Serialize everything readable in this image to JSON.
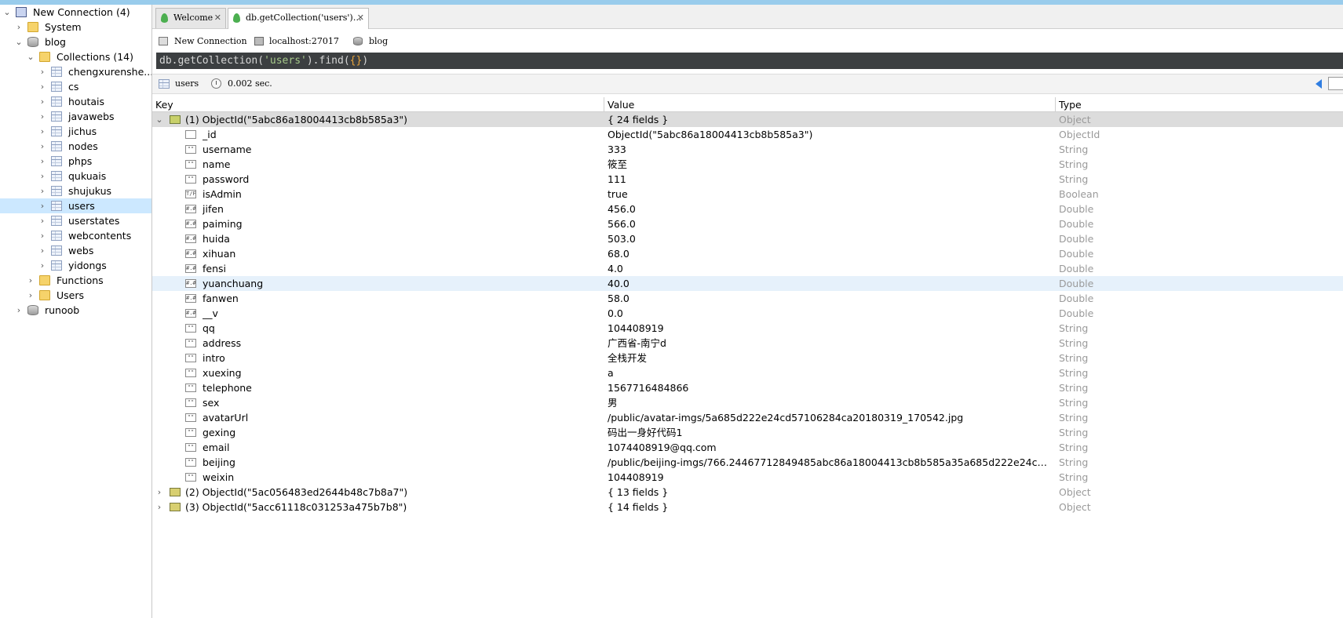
{
  "sidebar": {
    "items": [
      {
        "label": "New Connection (4)",
        "icon": "connection-icon",
        "depth": 0,
        "expand": "expanded"
      },
      {
        "label": "System",
        "icon": "folder-icon",
        "depth": 1,
        "expand": "collapsed"
      },
      {
        "label": "blog",
        "icon": "database-icon",
        "depth": 1,
        "expand": "expanded"
      },
      {
        "label": "Collections (14)",
        "icon": "folder-icon",
        "depth": 2,
        "expand": "expanded"
      },
      {
        "label": "chengxurenshe...",
        "icon": "collection-icon",
        "depth": 3,
        "expand": "collapsed"
      },
      {
        "label": "cs",
        "icon": "collection-icon",
        "depth": 3,
        "expand": "collapsed"
      },
      {
        "label": "houtais",
        "icon": "collection-icon",
        "depth": 3,
        "expand": "collapsed"
      },
      {
        "label": "javawebs",
        "icon": "collection-icon",
        "depth": 3,
        "expand": "collapsed"
      },
      {
        "label": "jichus",
        "icon": "collection-icon",
        "depth": 3,
        "expand": "collapsed"
      },
      {
        "label": "nodes",
        "icon": "collection-icon",
        "depth": 3,
        "expand": "collapsed"
      },
      {
        "label": "phps",
        "icon": "collection-icon",
        "depth": 3,
        "expand": "collapsed"
      },
      {
        "label": "qukuais",
        "icon": "collection-icon",
        "depth": 3,
        "expand": "collapsed"
      },
      {
        "label": "shujukus",
        "icon": "collection-icon",
        "depth": 3,
        "expand": "collapsed"
      },
      {
        "label": "users",
        "icon": "collection-icon",
        "depth": 3,
        "expand": "collapsed",
        "selected": true
      },
      {
        "label": "userstates",
        "icon": "collection-icon",
        "depth": 3,
        "expand": "collapsed"
      },
      {
        "label": "webcontents",
        "icon": "collection-icon",
        "depth": 3,
        "expand": "collapsed"
      },
      {
        "label": "webs",
        "icon": "collection-icon",
        "depth": 3,
        "expand": "collapsed"
      },
      {
        "label": "yidongs",
        "icon": "collection-icon",
        "depth": 3,
        "expand": "collapsed"
      },
      {
        "label": "Functions",
        "icon": "folder-icon",
        "depth": 2,
        "expand": "collapsed"
      },
      {
        "label": "Users",
        "icon": "folder-icon",
        "depth": 2,
        "expand": "collapsed"
      },
      {
        "label": "runoob",
        "icon": "database-icon",
        "depth": 1,
        "expand": "collapsed"
      }
    ]
  },
  "tabs": [
    {
      "label": "Welcome",
      "close": "✕",
      "active": false
    },
    {
      "label": "db.getCollection('users')…",
      "close": "✕",
      "active": true
    }
  ],
  "info": {
    "connection": "New Connection",
    "host": "localhost:27017",
    "database": "blog"
  },
  "query": {
    "prefix": "db.getCollection(",
    "collection_arg": "'users'",
    "middle": ").find(",
    "braces": "{}",
    "suffix": ")"
  },
  "result": {
    "collection": "users",
    "time": "0.002 sec."
  },
  "grid": {
    "headers": {
      "key": "Key",
      "value": "Value",
      "type": "Type"
    },
    "rows": [
      {
        "level": 0,
        "expand": "expanded",
        "icon": "object",
        "key": "(1) ObjectId(\"5abc86a18004413cb8b585a3\")",
        "value": "{ 24 fields }",
        "type": "Object",
        "selected": true
      },
      {
        "level": 1,
        "icon": "id",
        "key": "_id",
        "value": "ObjectId(\"5abc86a18004413cb8b585a3\")",
        "type": "ObjectId"
      },
      {
        "level": 1,
        "icon": "string",
        "key": "username",
        "value": "333",
        "type": "String"
      },
      {
        "level": 1,
        "icon": "string",
        "key": "name",
        "value": "筱至",
        "type": "String"
      },
      {
        "level": 1,
        "icon": "string",
        "key": "password",
        "value": "111",
        "type": "String"
      },
      {
        "level": 1,
        "icon": "boolean",
        "key": "isAdmin",
        "value": "true",
        "type": "Boolean"
      },
      {
        "level": 1,
        "icon": "number",
        "key": "jifen",
        "value": "456.0",
        "type": "Double"
      },
      {
        "level": 1,
        "icon": "number",
        "key": "paiming",
        "value": "566.0",
        "type": "Double"
      },
      {
        "level": 1,
        "icon": "number",
        "key": "huida",
        "value": "503.0",
        "type": "Double"
      },
      {
        "level": 1,
        "icon": "number",
        "key": "xihuan",
        "value": "68.0",
        "type": "Double"
      },
      {
        "level": 1,
        "icon": "number",
        "key": "fensi",
        "value": "4.0",
        "type": "Double"
      },
      {
        "level": 1,
        "icon": "number",
        "key": "yuanchuang",
        "value": "40.0",
        "type": "Double",
        "hover": true
      },
      {
        "level": 1,
        "icon": "number",
        "key": "fanwen",
        "value": "58.0",
        "type": "Double"
      },
      {
        "level": 1,
        "icon": "number",
        "key": "__v",
        "value": "0.0",
        "type": "Double"
      },
      {
        "level": 1,
        "icon": "string",
        "key": "qq",
        "value": "104408919",
        "type": "String"
      },
      {
        "level": 1,
        "icon": "string",
        "key": "address",
        "value": "广西省-南宁d",
        "type": "String"
      },
      {
        "level": 1,
        "icon": "string",
        "key": "intro",
        "value": "全栈开发",
        "type": "String"
      },
      {
        "level": 1,
        "icon": "string",
        "key": "xuexing",
        "value": "a",
        "type": "String"
      },
      {
        "level": 1,
        "icon": "string",
        "key": "telephone",
        "value": "1567716484866",
        "type": "String"
      },
      {
        "level": 1,
        "icon": "string",
        "key": "sex",
        "value": "男",
        "type": "String"
      },
      {
        "level": 1,
        "icon": "string",
        "key": "avatarUrl",
        "value": "/public/avatar-imgs/5a685d222e24cd57106284ca20180319_170542.jpg",
        "type": "String"
      },
      {
        "level": 1,
        "icon": "string",
        "key": "gexing",
        "value": "码出一身好代码1",
        "type": "String"
      },
      {
        "level": 1,
        "icon": "string",
        "key": "email",
        "value": "1074408919@qq.com",
        "type": "String"
      },
      {
        "level": 1,
        "icon": "string",
        "key": "beijing",
        "value": "/public/beijing-imgs/766.24467712849485abc86a18004413cb8b585a35a685d222e24cd5710628...",
        "type": "String"
      },
      {
        "level": 1,
        "icon": "string",
        "key": "weixin",
        "value": "104408919",
        "type": "String"
      },
      {
        "level": 0,
        "expand": "collapsed",
        "icon": "object2",
        "key": "(2) ObjectId(\"5ac056483ed2644b48c7b8a7\")",
        "value": "{ 13 fields }",
        "type": "Object"
      },
      {
        "level": 0,
        "expand": "collapsed",
        "icon": "object2",
        "key": "(3) ObjectId(\"5acc61118c031253a475b7b8\")",
        "value": "{ 14 fields }",
        "type": "Object"
      }
    ],
    "icon_glyphs": {
      "string": "\"\"",
      "number": "#.#",
      "boolean": "T/F",
      "id": "",
      "object": "",
      "object2": ""
    }
  },
  "expand_glyphs": {
    "expanded": "⌄",
    "collapsed": "›"
  },
  "colors": {
    "selection": "#cce8ff",
    "query_bg": "#3c3f41",
    "query_string": "#a6c98a",
    "query_brace": "#e8a33c",
    "nav_arrow": "#2f7de1"
  }
}
